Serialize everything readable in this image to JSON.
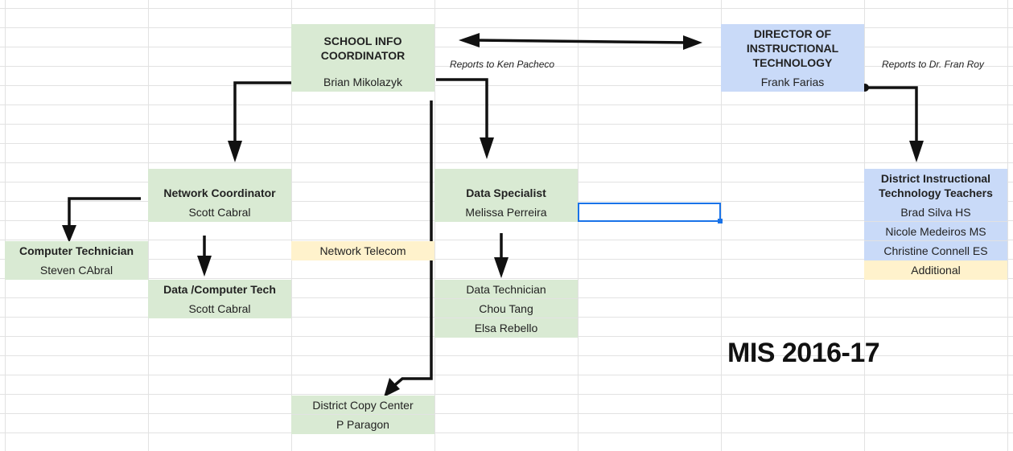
{
  "title": "MIS 2016-17",
  "notes": {
    "left": "Reports to Ken Pacheco",
    "right": "Reports to Dr. Fran Roy"
  },
  "school_info": {
    "title": "SCHOOL INFO COORDINATOR",
    "name": "Brian Mikolazyk"
  },
  "director": {
    "title": "DIRECTOR OF INSTRUCTIONAL TECHNOLOGY",
    "name": "Frank Farias"
  },
  "network": {
    "title": "Network Coordinator",
    "name": "Scott Cabral"
  },
  "data_specialist": {
    "title": "Data Specialist",
    "name": "Melissa Perreira"
  },
  "district_teachers": {
    "title": "District Instructional Technology Teachers",
    "members": [
      "Brad Silva HS",
      "Nicole Medeiros MS",
      "Christine Connell ES"
    ],
    "additional": "Additional"
  },
  "computer_tech": {
    "title": "Computer Technician",
    "name": "Steven CAbral"
  },
  "network_telecom": "Network Telecom",
  "data_computer_tech": {
    "title": "Data /Computer Tech",
    "name": "Scott Cabral"
  },
  "data_technician": {
    "title": "Data Technician",
    "members": [
      "Chou Tang",
      "Elsa Rebello"
    ]
  },
  "copy_center": {
    "title": "District Copy Center",
    "name": "P Paragon"
  }
}
